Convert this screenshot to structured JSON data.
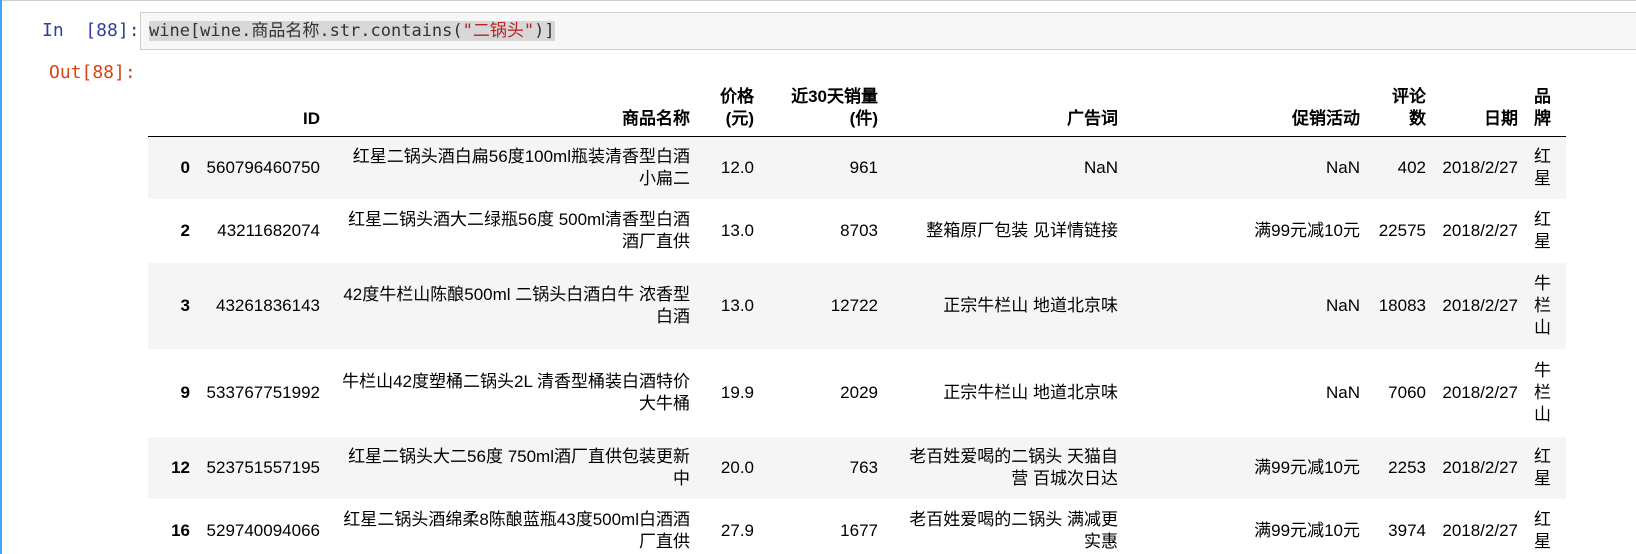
{
  "cell": {
    "in_prompt": "In  [88]:",
    "out_prompt": "Out[88]:",
    "code": {
      "part1": "wine[wine.商品名称.str.contains(",
      "string_literal": "\"二锅头\"",
      "part2": ")]"
    }
  },
  "table": {
    "columns": [
      "",
      "ID",
      "商品名称",
      "价格\n(元)",
      "近30天销量\n(件)",
      "广告词",
      "促销活动",
      "评论\n数",
      "日期",
      "品\n牌"
    ],
    "rows": [
      {
        "index": "0",
        "id": "560796460750",
        "name": "红星二锅头酒白扁56度100ml瓶装清香型白酒\n小扁二",
        "price": "12.0",
        "sales": "961",
        "ad": "NaN",
        "promo": "NaN",
        "reviews": "402",
        "date": "2018/2/27",
        "brand": "红\n星"
      },
      {
        "index": "2",
        "id": "43211682074",
        "name": "红星二锅头酒大二绿瓶56度 500ml清香型白酒\n酒厂直供",
        "price": "13.0",
        "sales": "8703",
        "ad": "整箱原厂包装 见详情链接",
        "promo": "满99元减10元",
        "reviews": "22575",
        "date": "2018/2/27",
        "brand": "红\n星"
      },
      {
        "index": "3",
        "id": "43261836143",
        "name": "42度牛栏山陈酿500ml 二锅头白酒白牛 浓香型\n白酒",
        "price": "13.0",
        "sales": "12722",
        "ad": "正宗牛栏山 地道北京味",
        "promo": "NaN",
        "reviews": "18083",
        "date": "2018/2/27",
        "brand": "牛\n栏\n山"
      },
      {
        "index": "9",
        "id": "533767751992",
        "name": "牛栏山42度塑桶二锅头2L 清香型桶装白酒特价\n大牛桶",
        "price": "19.9",
        "sales": "2029",
        "ad": "正宗牛栏山 地道北京味",
        "promo": "NaN",
        "reviews": "7060",
        "date": "2018/2/27",
        "brand": "牛\n栏\n山"
      },
      {
        "index": "12",
        "id": "523751557195",
        "name": "红星二锅头大二56度 750ml酒厂直供包装更新\n中",
        "price": "20.0",
        "sales": "763",
        "ad": "老百姓爱喝的二锅头 天猫自\n营 百城次日达",
        "promo": "满99元减10元",
        "reviews": "2253",
        "date": "2018/2/27",
        "brand": "红\n星"
      },
      {
        "index": "16",
        "id": "529740094066",
        "name": "红星二锅头酒绵柔8陈酿蓝瓶43度500ml白酒酒\n厂直供",
        "price": "27.9",
        "sales": "1677",
        "ad": "老百姓爱喝的二锅头 满减更\n实惠",
        "promo": "满99元减10元",
        "reviews": "3974",
        "date": "2018/2/27",
        "brand": "红\n星"
      }
    ]
  }
}
